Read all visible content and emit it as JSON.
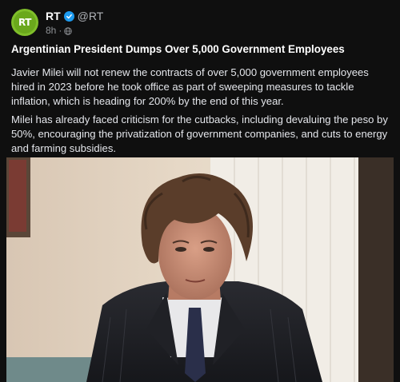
{
  "post": {
    "author_name": "RT",
    "author_handle": "@RT",
    "avatar_text": "RT",
    "time_ago": "8h",
    "separator": "·",
    "title": "Argentinian President Dumps Over 5,000 Government Employees",
    "paragraphs": [
      "Javier Milei will not renew the contracts of over 5,000 government employees hired in 2023 before he took office as part of sweeping measures to tackle inflation, which is heading for 200% by the end of this year.",
      "Milei has already faced criticism for the cutbacks, including devaluing the peso by 50%, encouraging the privatization of government companies, and cuts to energy and farming subsidies."
    ]
  },
  "colors": {
    "background": "#0f0f0f",
    "avatar_green": "#7fbe2a",
    "verified_blue": "#1d9bf0"
  },
  "icons": [
    "verified-badge-icon",
    "globe-icon"
  ]
}
